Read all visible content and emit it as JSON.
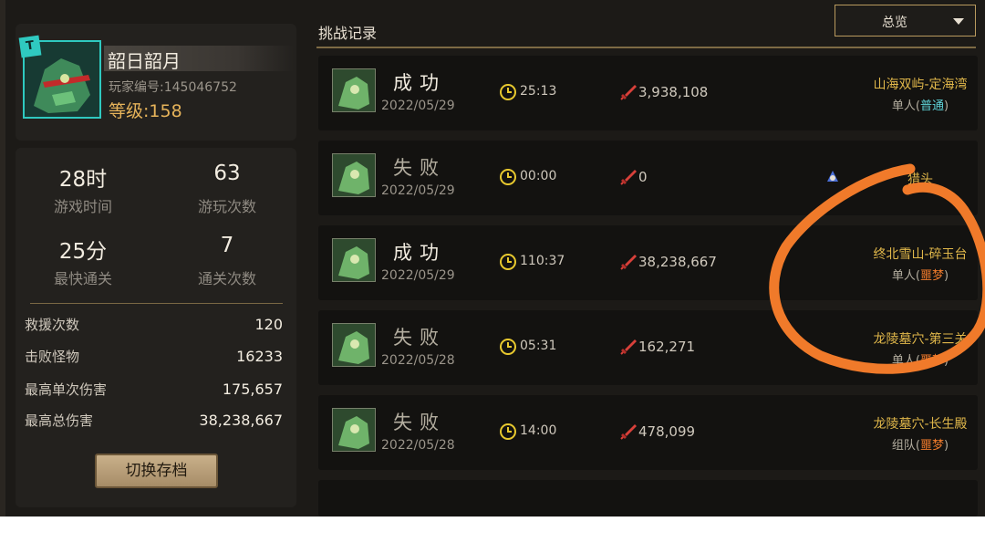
{
  "profile": {
    "name": "韶日韶月",
    "player_id": "玩家编号:145046752",
    "level": "等级:158",
    "badge": "T"
  },
  "stats": {
    "play_time": {
      "value": "28时",
      "label": "游戏时间"
    },
    "play_count": {
      "value": "63",
      "label": "游玩次数"
    },
    "fastest_clear": {
      "value": "25分",
      "label": "最快通关"
    },
    "clear_count": {
      "value": "7",
      "label": "通关次数"
    },
    "rows": [
      {
        "label": "救援次数",
        "value": "120"
      },
      {
        "label": "击败怪物",
        "value": "16233"
      },
      {
        "label": "最高单次伤害",
        "value": "175,657"
      },
      {
        "label": "最高总伤害",
        "value": "38,238,667"
      }
    ],
    "switch_button": "切换存档"
  },
  "header": {
    "title": "挑战记录",
    "filter_selected": "总览"
  },
  "records": [
    {
      "result": "成功",
      "date": "2022/05/29",
      "time": "25:13",
      "damage": "3,938,108",
      "map": "山海双屿-定海湾",
      "mode": "单人(",
      "difficulty": "普通",
      "close": ")"
    },
    {
      "result": "失败",
      "date": "2022/05/29",
      "time": "00:00",
      "damage": "0",
      "map": "猎头",
      "mode": "",
      "difficulty": "",
      "close": ""
    },
    {
      "result": "成功",
      "date": "2022/05/29",
      "time": "110:37",
      "damage": "38,238,667",
      "map": "终北雪山-碎玉台",
      "mode": "单人(",
      "difficulty": "噩梦",
      "close": ")"
    },
    {
      "result": "失败",
      "date": "2022/05/28",
      "time": "05:31",
      "damage": "162,271",
      "map": "龙陵墓穴-第三关",
      "mode": "单人(",
      "difficulty": "噩梦",
      "close": ")"
    },
    {
      "result": "失败",
      "date": "2022/05/28",
      "time": "14:00",
      "damage": "478,099",
      "map": "龙陵墓穴-长生殿",
      "mode": "组队(",
      "difficulty": "噩梦",
      "close": ")"
    }
  ],
  "colors": {
    "accent_gold": "#e0b74a",
    "difficulty_normal": "#5fd3d8",
    "difficulty_nightmare": "#ef7a2b",
    "annotation_circle": "#f07a2a"
  },
  "icons": {
    "time": "clock-icon",
    "damage": "sword-icon",
    "dropdown": "chevron-down-icon"
  }
}
